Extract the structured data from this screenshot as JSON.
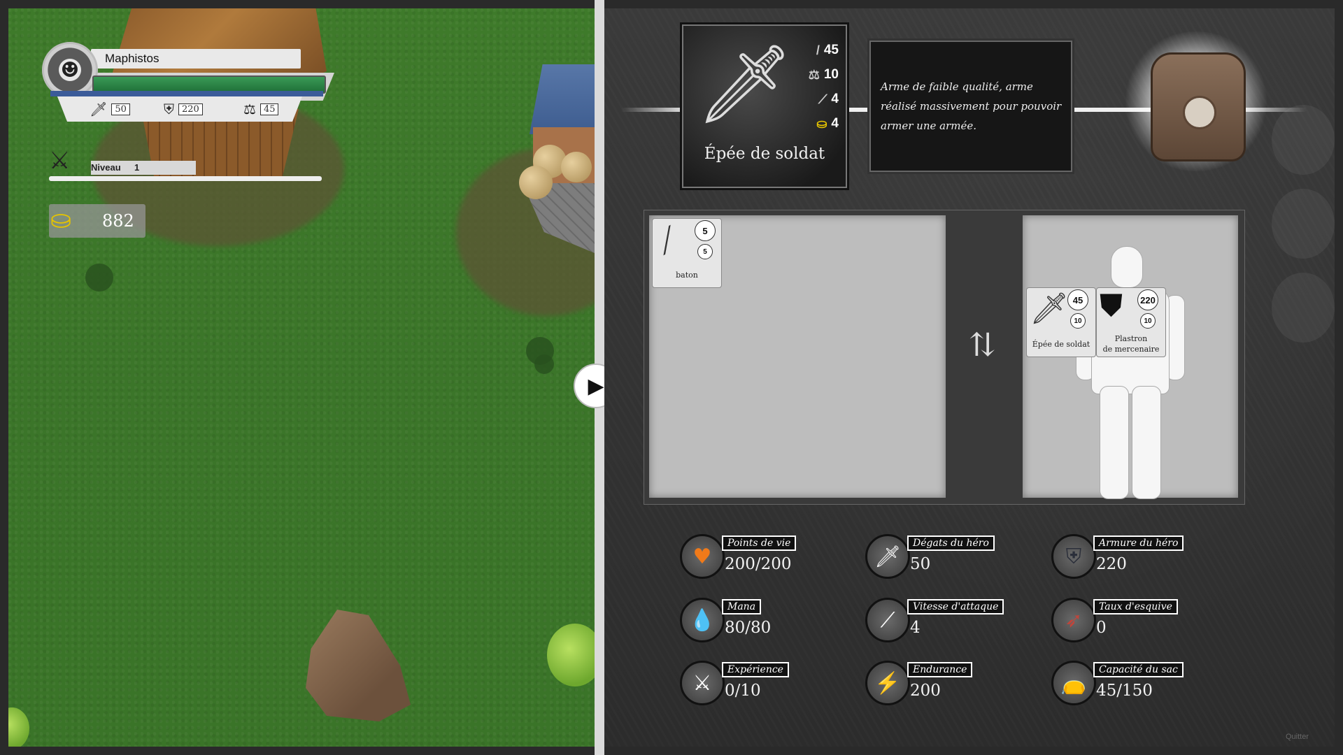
{
  "hud": {
    "player_name": "Maphistos",
    "attack": "50",
    "armor": "220",
    "weight": "45",
    "level_label": "Niveau",
    "level_value": "1",
    "gold": "882"
  },
  "selected_item": {
    "name": "Épée de soldat",
    "damage": "45",
    "weight": "10",
    "speed": "4",
    "price": "4",
    "description": "Arme de faible qualité, arme réalisé massivement pour pouvoir armer une armée."
  },
  "inventory": {
    "items": [
      {
        "name": "baton",
        "damage": "5",
        "weight": "5"
      }
    ]
  },
  "equipment": {
    "weapon": {
      "name": "Épée de soldat",
      "damage": "45",
      "weight": "10"
    },
    "armor": {
      "name_line1": "Plastron",
      "name_line2": "de mercenaire",
      "armor": "220",
      "weight": "10"
    }
  },
  "stats": [
    {
      "label": "Points de vie",
      "value": "200/200",
      "icon": "heart-icon",
      "color": "#f07a1a"
    },
    {
      "label": "Dégats du héro",
      "value": "50",
      "icon": "sword-icon",
      "color": "#ffffff"
    },
    {
      "label": "Armure du héro",
      "value": "220",
      "icon": "shield-icon",
      "color": "#2b2f3a"
    },
    {
      "label": "Mana",
      "value": "80/80",
      "icon": "drop-icon",
      "color": "#1e5bbf"
    },
    {
      "label": "Vitesse d'attaque",
      "value": "4",
      "icon": "speed-sword-icon",
      "color": "#ffffff"
    },
    {
      "label": "Taux d'esquive",
      "value": "0",
      "icon": "dodge-icon",
      "color": "#c0453b"
    },
    {
      "label": "Expérience",
      "value": "0/10",
      "icon": "crossed-swords-icon",
      "color": "#ffffff"
    },
    {
      "label": "Endurance",
      "value": "200",
      "icon": "lightning-icon",
      "color": "#ffcc00"
    },
    {
      "label": "Capacité du sac",
      "value": "45/150",
      "icon": "bag-icon",
      "color": "#8a6f5a"
    }
  ],
  "footer": {
    "quit_label": "Quitter"
  },
  "icons": {
    "toggle": "play-arrow-icon",
    "swap": "swap-arrows-icon"
  }
}
